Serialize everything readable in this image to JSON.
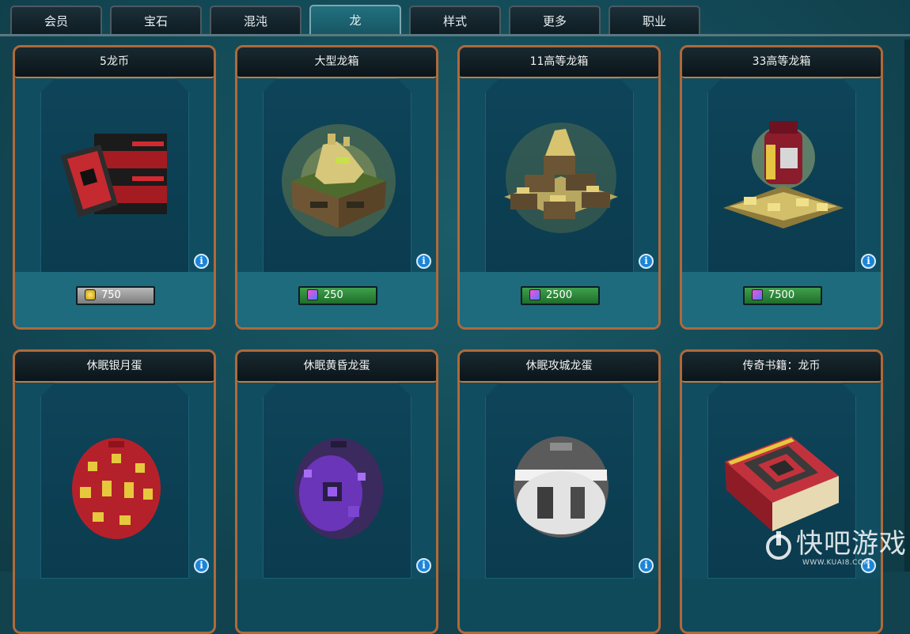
{
  "tabs": [
    {
      "label": "会员",
      "active": false
    },
    {
      "label": "宝石",
      "active": false
    },
    {
      "label": "混沌",
      "active": false
    },
    {
      "label": "龙",
      "active": true
    },
    {
      "label": "样式",
      "active": false
    },
    {
      "label": "更多",
      "active": false
    },
    {
      "label": "职业",
      "active": false
    }
  ],
  "items": [
    {
      "title": "5龙币",
      "currency": "gold",
      "price": "750",
      "art": "red-coin-stack"
    },
    {
      "title": "大型龙箱",
      "currency": "gem",
      "price": "250",
      "art": "large-dragon-chest"
    },
    {
      "title": "11高等龙箱",
      "currency": "gem",
      "price": "2500",
      "art": "chest-pile"
    },
    {
      "title": "33高等龙箱",
      "currency": "gem",
      "price": "7500",
      "art": "coin-bag-chests"
    },
    {
      "title": "休眠银月蛋",
      "currency": "",
      "price": "",
      "art": "red-gold-egg"
    },
    {
      "title": "休眠黄昏龙蛋",
      "currency": "",
      "price": "",
      "art": "purple-egg"
    },
    {
      "title": "休眠攻城龙蛋",
      "currency": "",
      "price": "",
      "art": "silver-egg"
    },
    {
      "title": "传奇书籍：龙币",
      "currency": "",
      "price": "",
      "art": "red-book"
    }
  ],
  "info_icon": "i",
  "colors": {
    "card_border": "#b0693a",
    "tab_active": "#22707f",
    "gem_price": "#2f8a3c",
    "gold_price": "#9a9a9a"
  },
  "watermark": {
    "text": "快吧游戏",
    "url": "WWW.KUAI8.COM"
  }
}
